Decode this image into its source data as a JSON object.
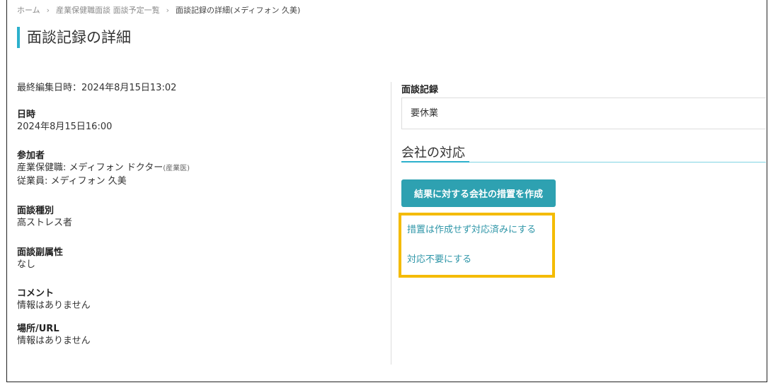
{
  "breadcrumb": {
    "items": [
      {
        "label": "ホーム"
      },
      {
        "label": "産業保健職面談 面談予定一覧"
      }
    ],
    "current": "面談記録の詳細(メディフォン 久美)"
  },
  "page": {
    "title": "面談記録の詳細"
  },
  "details": {
    "last_edited": "最終編集日時：2024年8月15日13:02",
    "datetime": {
      "label": "日時",
      "value": "2024年8月15日16:00"
    },
    "participants": {
      "label": "参加者",
      "staff_prefix": "産業保健職: メディフォン ドクター",
      "staff_role": "(産業医)",
      "employee": "従業員: メディフォン 久美"
    },
    "interview_type": {
      "label": "面談種別",
      "value": "高ストレス者"
    },
    "sub_attribute": {
      "label": "面談副属性",
      "value": "なし"
    },
    "comment": {
      "label": "コメント",
      "value": "情報はありません"
    },
    "location": {
      "label": "場所/URL",
      "value": "情報はありません"
    }
  },
  "record": {
    "label": "面談記録",
    "value": "要休業"
  },
  "company_response": {
    "heading": "会社の対応",
    "create_button_label": "結果に対する会社の措置を作成",
    "link_mark_done": "措置は作成せず対応済みにする",
    "link_not_required": "対応不要にする"
  },
  "colors": {
    "accent": "#2cb0cc",
    "button": "#2ea1b1",
    "link": "#2f96a8",
    "highlight": "#f4bb00"
  }
}
